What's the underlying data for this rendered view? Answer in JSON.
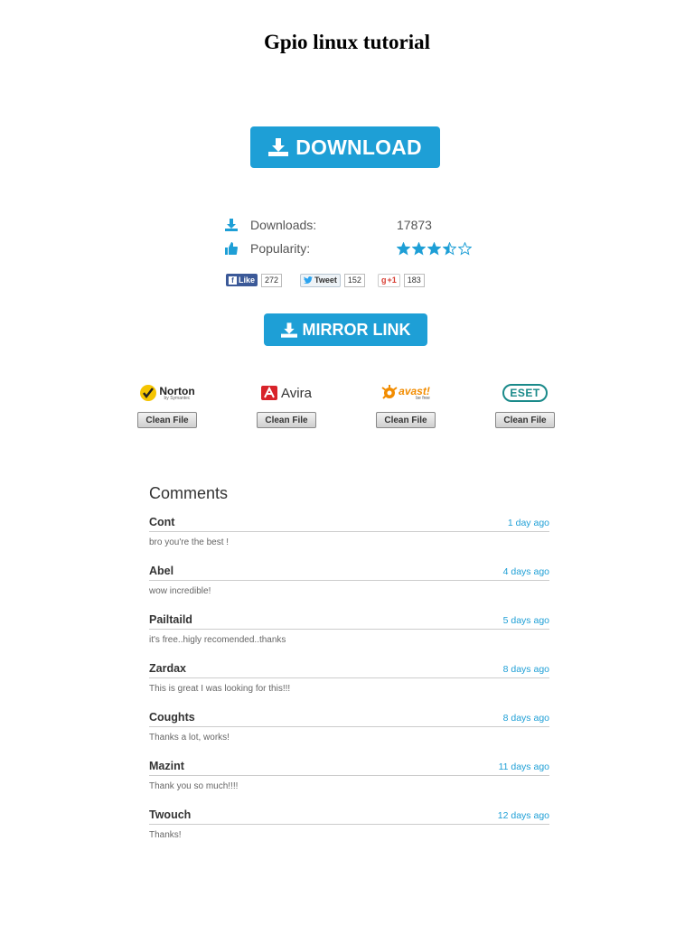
{
  "title": "Gpio linux tutorial",
  "download_button": "DOWNLOAD",
  "mirror_button": "MIRROR LINK",
  "stats": {
    "downloads_label": "Downloads:",
    "downloads_value": "17873",
    "popularity_label": "Popularity:",
    "rating": 3.5,
    "rating_max": 5
  },
  "social": {
    "facebook_label": "Like",
    "facebook_count": "272",
    "twitter_label": "Tweet",
    "twitter_count": "152",
    "gplus_label": "+1",
    "gplus_count": "183"
  },
  "antivirus": [
    {
      "name": "Norton",
      "sub": "by Symantec",
      "button": "Clean File"
    },
    {
      "name": "Avira",
      "button": "Clean File"
    },
    {
      "name": "avast!",
      "sub": "be free",
      "button": "Clean File"
    },
    {
      "name": "ESET",
      "button": "Clean File"
    }
  ],
  "comments_title": "Comments",
  "comments": [
    {
      "name": "Cont",
      "date": "1 day ago",
      "text": "bro you're the best !"
    },
    {
      "name": "Abel",
      "date": "4 days ago",
      "text": "wow incredible!"
    },
    {
      "name": "Pailtaild",
      "date": "5 days ago",
      "text": "it's free..higly recomended..thanks"
    },
    {
      "name": "Zardax",
      "date": "8 days ago",
      "text": "This is great I was looking for this!!!"
    },
    {
      "name": "Coughts",
      "date": "8 days ago",
      "text": "Thanks a lot, works!"
    },
    {
      "name": "Mazint",
      "date": "11 days ago",
      "text": "Thank you so much!!!!"
    },
    {
      "name": "Twouch",
      "date": "12 days ago",
      "text": "Thanks!"
    }
  ],
  "colors": {
    "accent": "#1e9fd6",
    "facebook": "#3b5998"
  }
}
